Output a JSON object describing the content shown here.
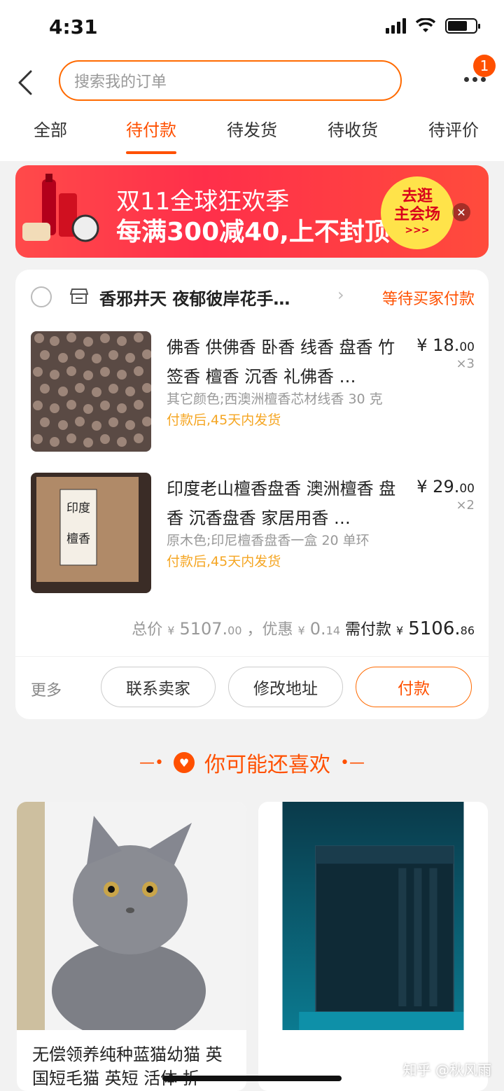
{
  "status_bar": {
    "time": "4:31"
  },
  "header": {
    "search_placeholder": "搜索我的订单",
    "notification_count": "1",
    "tabs": [
      {
        "label": "全部",
        "active": false
      },
      {
        "label": "待付款",
        "active": true
      },
      {
        "label": "待发货",
        "active": false
      },
      {
        "label": "待收货",
        "active": false
      },
      {
        "label": "待评价",
        "active": false
      }
    ]
  },
  "banner": {
    "line1": "双11全球狂欢季",
    "line2": "每满300减40,上不封顶",
    "cta_line1": "去逛",
    "cta_line2": "主会场",
    "cta_arrow": ">>>",
    "close_symbol": "✕"
  },
  "order": {
    "store_name": "香邪井天 夜郁彼岸花手…",
    "status": "等待买家付款",
    "items": [
      {
        "title": "佛香 供佛香 卧香 线香 盘香 竹签香 檀香 沉香 礼佛香 …",
        "variant": "其它颜色;西澳洲檀香芯材线香 30 克",
        "ship": "付款后,45天内发货",
        "price_int": "¥ 18.",
        "price_dec": "00",
        "qty": "×3"
      },
      {
        "title": "印度老山檀香盘香 澳洲檀香 盘香 沉香盘香 家居用香 …",
        "variant": "原木色;印尼檀香盘香一盒 20 单环",
        "ship": "付款后,45天内发货",
        "price_int": "¥ 29.",
        "price_dec": "00",
        "qty": "×2"
      }
    ],
    "total_label": "总价",
    "total_int": "5107.",
    "total_dec": "00",
    "discount_label": "，优惠",
    "discount_int": "0.",
    "discount_dec": "14",
    "need_pay_label": "需付款",
    "need_pay_int": "5106.",
    "need_pay_dec": "86",
    "currency": "¥",
    "actions": {
      "more": "更多",
      "contact": "联系卖家",
      "address": "修改地址",
      "pay": "付款"
    }
  },
  "recommend": {
    "heading": "你可能还喜欢",
    "products": [
      {
        "name": "无偿领养纯种蓝猫幼猫 英国短毛猫 英短 活体 折"
      },
      {
        "name": ""
      }
    ]
  },
  "watermark": "知乎 @秋风雨",
  "colors": {
    "accent": "#ff5000",
    "ship": "#f5a623"
  }
}
